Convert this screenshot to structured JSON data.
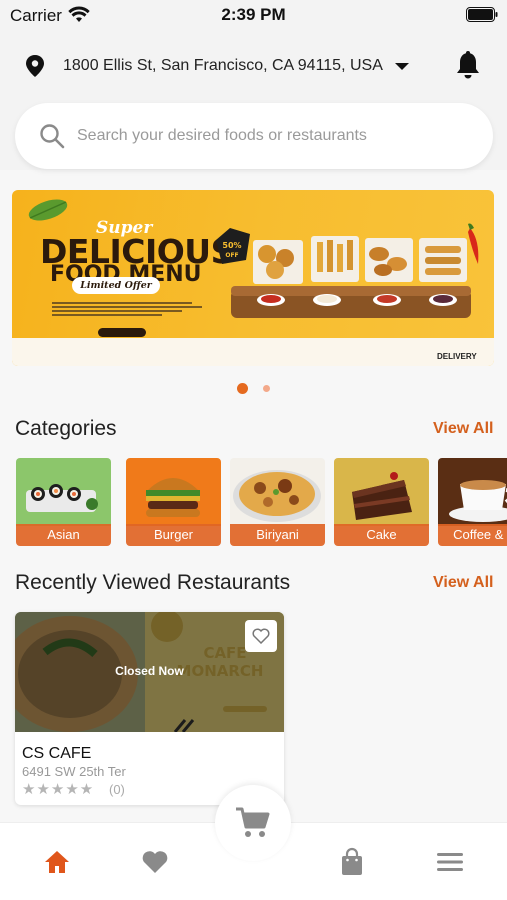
{
  "status_bar": {
    "carrier": "Carrier",
    "time": "2:39 PM"
  },
  "header": {
    "address": "1800 Ellis St, San Francisco, CA 94115, USA",
    "icons": [
      "location-pin-icon",
      "caret-down-icon",
      "bell-icon"
    ]
  },
  "search": {
    "placeholder": "Search your desired foods or restaurants"
  },
  "banner": {
    "super": "Super",
    "title_line1": "DELICIOUS",
    "title_line2": "FOOD MENU",
    "offer": "Limited Offer",
    "discount": "50% OFF",
    "delivery": "DELIVERY",
    "pages": 2,
    "active_page": 1
  },
  "categories": {
    "title": "Categories",
    "view_all": "View All",
    "items": [
      {
        "label": "Asian"
      },
      {
        "label": "Burger"
      },
      {
        "label": "Biriyani"
      },
      {
        "label": "Cake"
      },
      {
        "label": "Coffee & ..."
      }
    ]
  },
  "recently_viewed": {
    "title": "Recently Viewed Restaurants",
    "view_all": "View All",
    "restaurants": [
      {
        "name": "CS CAFE",
        "address": "6491 SW 25th Ter",
        "status": "Closed Now",
        "rating": 0,
        "stars": "★★★★★",
        "reviews": "(0)"
      }
    ]
  },
  "bottom_nav": {
    "items": [
      "home-icon",
      "heart-icon",
      "cart-icon",
      "bag-icon",
      "menu-icon"
    ],
    "active": "home-icon"
  },
  "colors": {
    "accent": "#d4601d",
    "active_nav": "#e0561b",
    "inactive_nav": "#8a8a8a"
  }
}
